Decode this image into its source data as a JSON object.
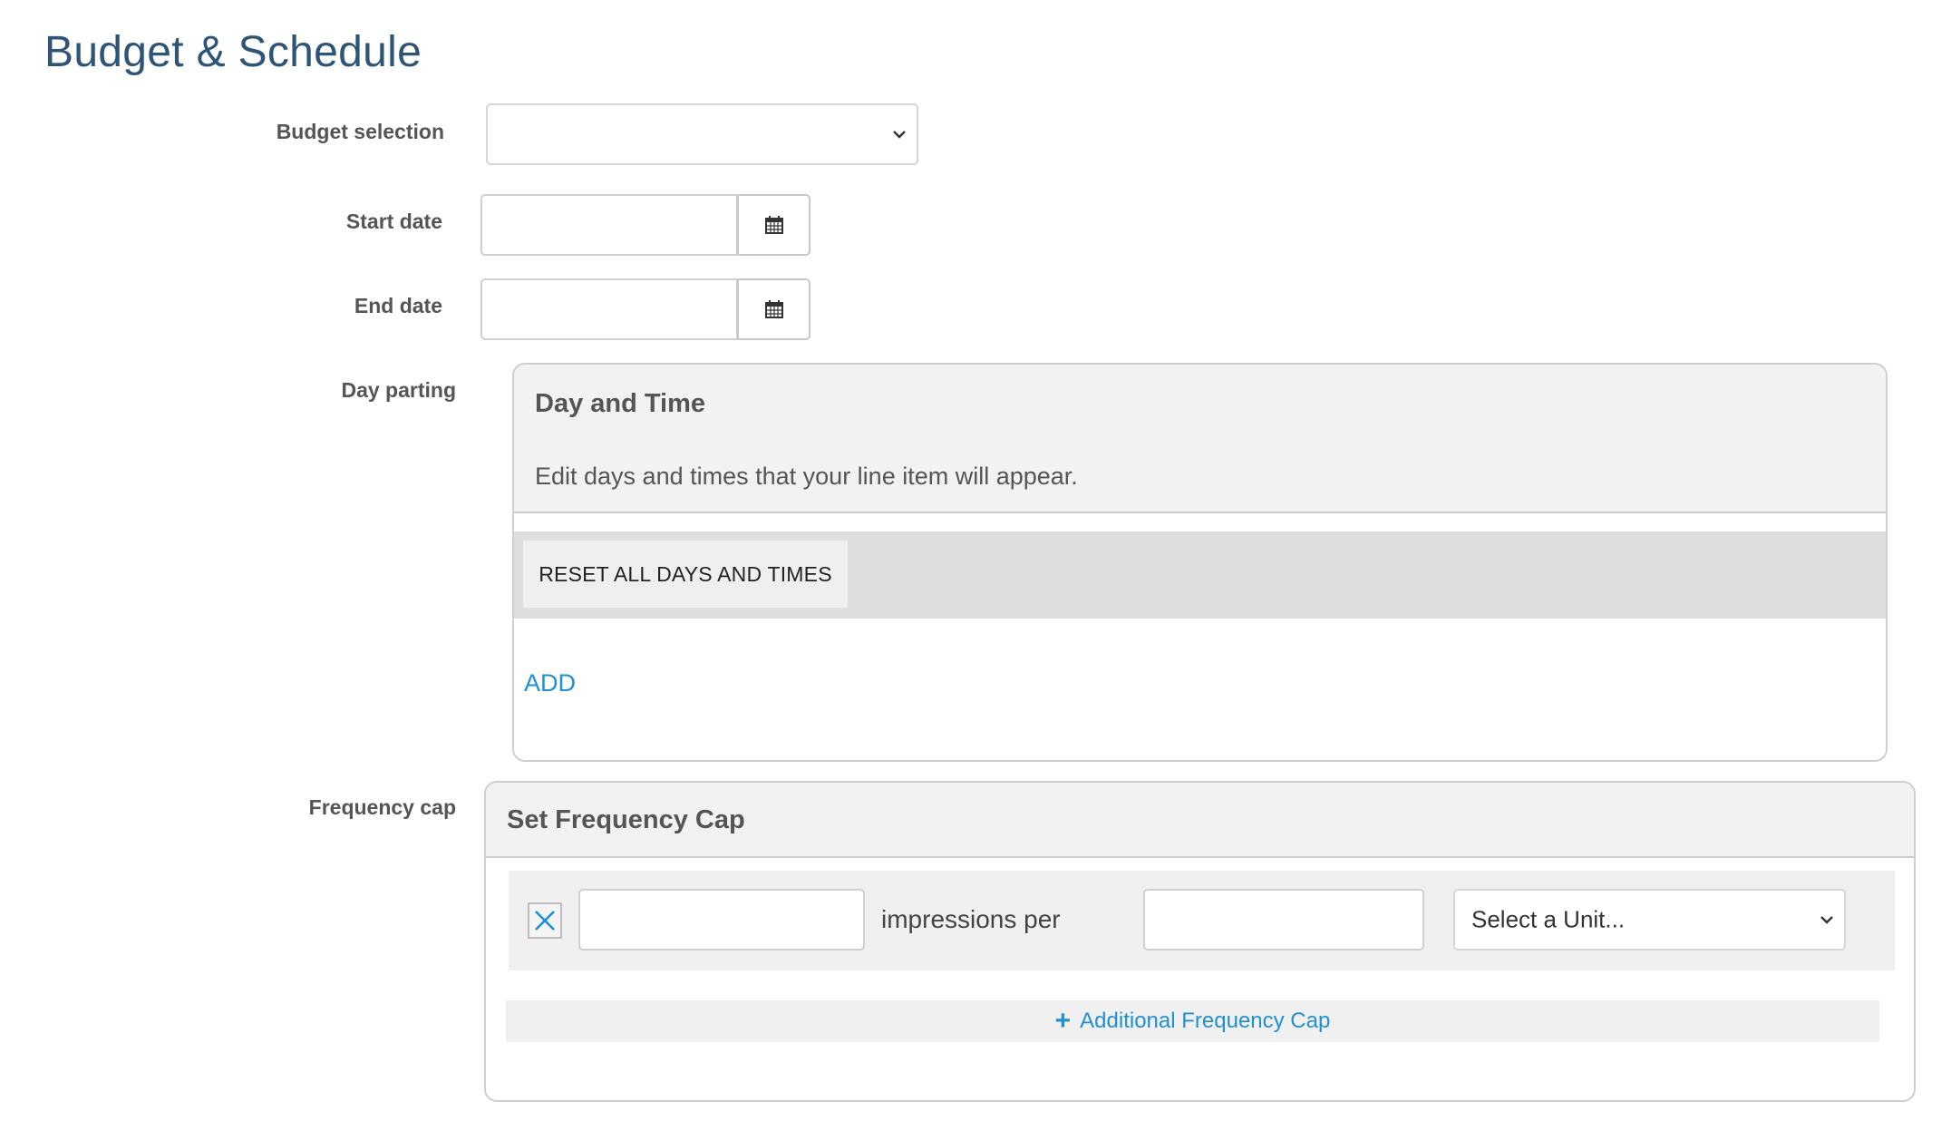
{
  "page": {
    "title": "Budget & Schedule"
  },
  "form": {
    "budget_selection": {
      "label": "Budget selection",
      "value": "",
      "icon": "chevron-down-icon"
    },
    "start_date": {
      "label": "Start date",
      "value": "",
      "icon": "calendar-icon"
    },
    "end_date": {
      "label": "End date",
      "value": "",
      "icon": "calendar-icon"
    },
    "day_parting": {
      "label": "Day parting",
      "panel_title": "Day and Time",
      "panel_description": "Edit days and times that your line item will appear.",
      "reset_label": "RESET ALL DAYS AND TIMES",
      "add_label": "ADD"
    },
    "frequency_cap": {
      "label": "Frequency cap",
      "panel_title": "Set Frequency Cap",
      "rows": [
        {
          "impressions_value": "",
          "connector_text": "impressions per",
          "period_value": "",
          "unit_selected": "Select a Unit...",
          "remove_icon": "close-icon"
        }
      ],
      "add_cap_label": "Additional Frequency Cap",
      "add_cap_icon": "plus-icon"
    }
  },
  "colors": {
    "title": "#2e5478",
    "link": "#2190d0",
    "panel_header": "#f2f2f2",
    "reset_bar": "#dedede"
  }
}
